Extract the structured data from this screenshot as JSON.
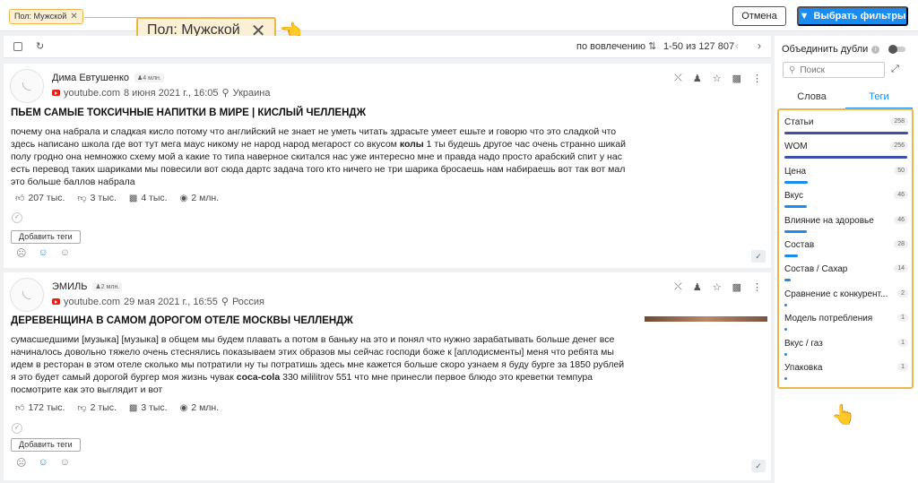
{
  "filter": {
    "chip_small_label": "Пол: Мужской",
    "chip_big_label": "Пол: Мужской",
    "cancel_label": "Отмена",
    "apply_label": "Выбрать фильтры"
  },
  "listbar": {
    "sort_label": "по вовлечению",
    "range": "1-50 из 127 807"
  },
  "posts": [
    {
      "author": "Дима Евтушенко",
      "subscribers": "4 млн.",
      "source": "youtube.com",
      "date": "8 июня 2021 г., 16:05",
      "location": "Украина",
      "title": "ПЬЕМ САМЫЕ ТОКСИЧНЫЕ НАПИТКИ В МИРЕ | КИСЛЫЙ ЧЕЛЛЕНДЖ",
      "text_before": "почему она набрала и сладкая кисло потому что английский не знает не уметь читать здрасьте умеет ешьте и говорю что это сладкой что здесь написано школа где вот тут мега маус никому не народ народ мегарост со вкусом ",
      "text_bold": "колы",
      "text_after": " 1 ты будешь другое час очень странно шикай полу гродно она немножко схему мой а какие то типа наверное скитался нас уже интересно мне и правда надо просто арабский спит у нас есть перевод таких шариками мы повесили вот сюда дартс задача того кто ничего не три шарика бросаешь нам набираешь вот так вот мал это больше баллов набрала",
      "likes": "207 тыс.",
      "dislikes": "3 тыс.",
      "comments": "4 тыс.",
      "views": "2 млн.",
      "add_tags_label": "Добавить теги"
    },
    {
      "author": "ЭМИЛЬ",
      "subscribers": "2 млн.",
      "source": "youtube.com",
      "date": "29 мая 2021 г., 16:55",
      "location": "Россия",
      "title": "ДЕРЕВЕНЩИНА В САМОМ ДОРОГОМ ОТЕЛЕ МОСКВЫ ЧЕЛЛЕНДЖ",
      "text_before": "сумасшедшими [музыка] [музыка] в общем мы будем плавать а потом в баньку на это и понял что нужно зарабатывать больше денег все начиналось довольно тяжело очень стеснялись показываем этих образов мы сейчас господи боже к [аплодисменты] меня что ребята мы идем в ресторан в этом отеле сколько мы потратили ну ты потратишь здесь мне кажется больше скоро узнаем я буду бурге за 1850 рублей я это будет самый дорогой бургер моя жизнь чувак ",
      "text_bold": "coca-cola",
      "text_after": " 330 мililitrov 551 что мне принесли первое блюдо это креветки темпура посмотрите как это выглядит и вот",
      "likes": "172 тыс.",
      "dislikes": "2 тыс.",
      "comments": "3 тыс.",
      "views": "2 млн.",
      "add_tags_label": "Добавить теги"
    }
  ],
  "panel": {
    "merge_label": "Объединить дубли",
    "search_placeholder": "Поиск",
    "tab_words": "Слова",
    "tab_tags": "Теги",
    "tags": [
      {
        "name": "Статьи",
        "count": "258",
        "fraction": 1.0
      },
      {
        "name": "WOM",
        "count": "256",
        "fraction": 0.99
      },
      {
        "name": "Цена",
        "count": "50",
        "fraction": 0.19
      },
      {
        "name": "Вкус",
        "count": "46",
        "fraction": 0.18
      },
      {
        "name": "Влияние на здоровье",
        "count": "46",
        "fraction": 0.18
      },
      {
        "name": "Состав",
        "count": "28",
        "fraction": 0.11
      },
      {
        "name": "Состав / Сахар",
        "count": "14",
        "fraction": 0.05
      },
      {
        "name": "Сравнение с конкурент...",
        "count": "2",
        "fraction": 0.01
      },
      {
        "name": "Модель потребления",
        "count": "1",
        "fraction": 0.01
      },
      {
        "name": "Вкус / газ",
        "count": "1",
        "fraction": 0.01
      },
      {
        "name": "Упаковка",
        "count": "1",
        "fraction": 0.01
      }
    ]
  },
  "colors": {
    "accent": "#1a8cf0",
    "highlight": "#e8b94a",
    "bar_dark": "#3c4fae"
  }
}
